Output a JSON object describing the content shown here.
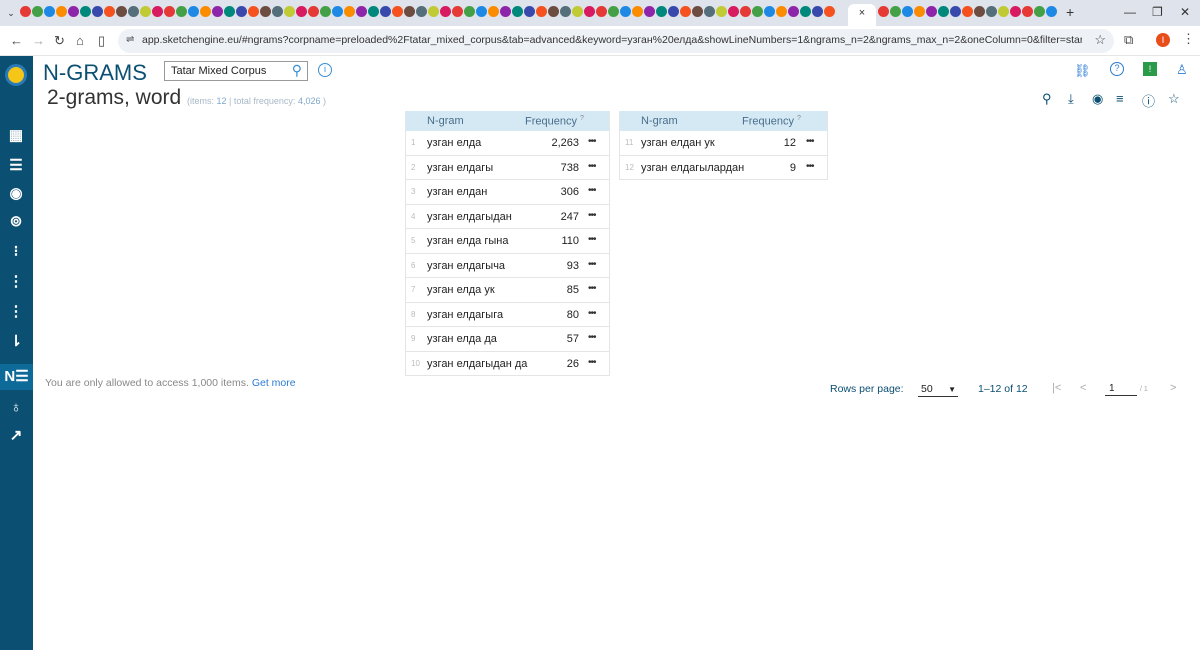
{
  "browser": {
    "active_tab_close": "×",
    "new_tab": "+",
    "url": "app.sketchengine.eu/#ngrams?corpname=preloaded%2Ftatar_mixed_corpus&tab=advanced&keyword=узган%20елда&showLineNumbers=1&ngrams_n=2&ngrams_max_n=2&oneColumn=0&filter=startingWith&showresults=1&itemsPerPa...",
    "profile_initial": "I"
  },
  "header": {
    "title": "N-GRAMS",
    "corpus": "Tatar Mixed Corpus",
    "subtitle": "2-grams, word",
    "items_label": "(items:",
    "items_value": "12",
    "freq_label": "| total frequency:",
    "freq_value": "4,026",
    "close_paren": ")"
  },
  "table": {
    "col_ngram": "N-gram",
    "col_freq": "Frequency",
    "help_mark": "?",
    "rows": [
      {
        "idx": "1",
        "ngram": "узган елда",
        "freq": "2,263"
      },
      {
        "idx": "2",
        "ngram": "узган елдагы",
        "freq": "738"
      },
      {
        "idx": "3",
        "ngram": "узган елдан",
        "freq": "306"
      },
      {
        "idx": "4",
        "ngram": "узган елдагыдан",
        "freq": "247"
      },
      {
        "idx": "5",
        "ngram": "узган елда гына",
        "freq": "110"
      },
      {
        "idx": "6",
        "ngram": "узган елдагыча",
        "freq": "93"
      },
      {
        "idx": "7",
        "ngram": "узган елда ук",
        "freq": "85"
      },
      {
        "idx": "8",
        "ngram": "узган елдагыга",
        "freq": "80"
      },
      {
        "idx": "9",
        "ngram": "узган елда да",
        "freq": "57"
      },
      {
        "idx": "10",
        "ngram": "узган елдагыдан да",
        "freq": "26"
      },
      {
        "idx": "11",
        "ngram": "узган елдан ук",
        "freq": "12"
      },
      {
        "idx": "12",
        "ngram": "узган елдагылардан",
        "freq": "9"
      }
    ]
  },
  "footer": {
    "limit_text": "You are only allowed to access 1,000 items.",
    "get_more": "Get more",
    "rows_per_page_label": "Rows per page:",
    "rows_per_page_value": "50",
    "range": "1–12 of 12",
    "page": "1",
    "page_total": "/ 1"
  },
  "colors": {
    "sidebar": "#0b4f72",
    "table_header": "#d5e9f5",
    "accent": "#2b7bd3"
  }
}
